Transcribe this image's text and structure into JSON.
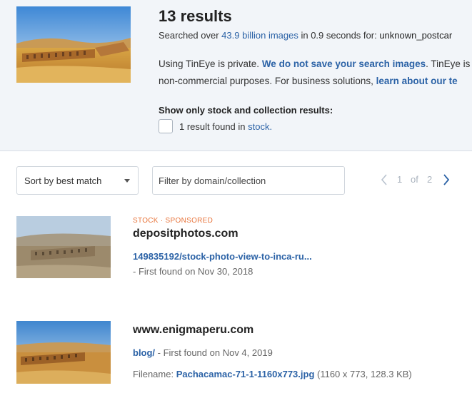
{
  "summary": {
    "results_title": "13 results",
    "searched_prefix": "Searched over ",
    "image_count": "43.9 billion images",
    "searched_mid": " in 0.9 seconds for: ",
    "query_filename": "unknown_postcar"
  },
  "privacy": {
    "line1_prefix": "Using TinEye is private. ",
    "line1_link": "We do not save your search images",
    "line1_suffix": ". TinEye is",
    "line2_prefix": "non-commercial purposes. For business solutions, ",
    "line2_link": "learn about our te"
  },
  "stock_filter": {
    "heading": "Show only stock and collection results:",
    "found_prefix": "1 result found in ",
    "found_link": "stock."
  },
  "controls": {
    "sort_label": "Sort by best match",
    "filter_placeholder": "Filter by domain/collection",
    "page_current": "1",
    "page_of": "of",
    "page_total": "2"
  },
  "results": [
    {
      "tag": "STOCK · SPONSORED",
      "domain": "depositphotos.com",
      "link": "149835192/stock-photo-view-to-inca-ru...",
      "found": "- First found on Nov 30, 2018"
    },
    {
      "domain": "www.enigmaperu.com",
      "link": "blog/",
      "found": " - First found on Nov 4, 2019",
      "filename_label": "Filename: ",
      "filename": "Pachacamac-71-1-1160x773.jpg",
      "file_info": " (1160 x 773, 128.3 KB)"
    }
  ],
  "icons": [
    "query-image-thumbnail",
    "checkbox",
    "dropdown-caret-icon",
    "chevron-left-icon",
    "chevron-right-icon"
  ],
  "colors": {
    "link": "#2b62a6",
    "stock_tag": "#e8743b",
    "header_bg": "#f2f5f9"
  }
}
